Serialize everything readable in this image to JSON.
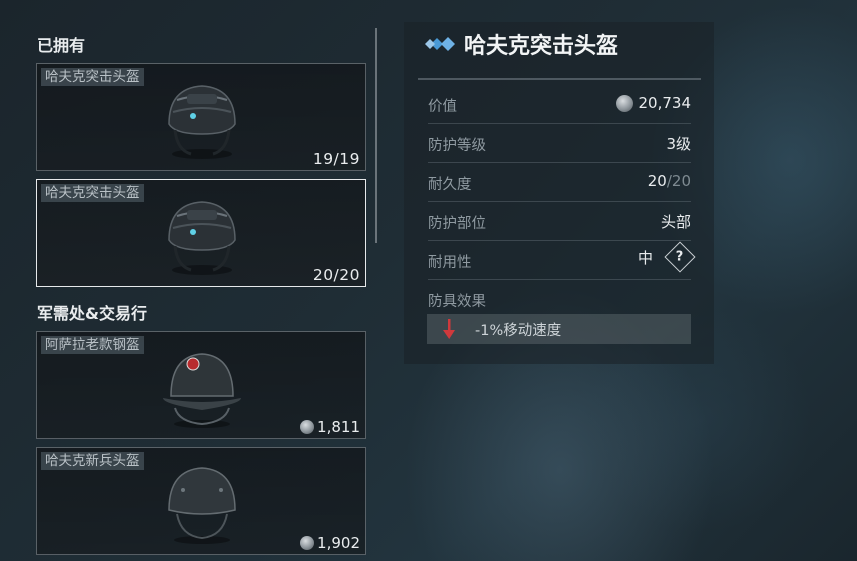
{
  "owned": {
    "title": "已拥有",
    "items": [
      {
        "name": "哈夫克突击头盔",
        "count": "19/19"
      },
      {
        "name": "哈夫克突击头盔",
        "count": "20/20"
      }
    ]
  },
  "market": {
    "title": "军需处&交易行",
    "items": [
      {
        "name": "阿萨拉老款钢盔",
        "price": "1,811"
      },
      {
        "name": "哈夫克新兵头盔",
        "price": "1,902"
      }
    ]
  },
  "detail": {
    "name": "哈夫克突击头盔",
    "value_label": "价值",
    "value": "20,734",
    "protection_label": "防护等级",
    "protection": "3级",
    "durability_label": "耐久度",
    "durability_current": "20",
    "durability_sep": "/",
    "durability_max": "20",
    "area_label": "防护部位",
    "area": "头部",
    "usability_label": "耐用性",
    "usability": "中",
    "help_glyph": "?",
    "effect_label": "防具效果",
    "effect": "-1%移动速度"
  },
  "colors": {
    "accent": "#5aa6e0",
    "debuff": "#d0393c",
    "selected_border": "#e6e9eb"
  },
  "icons": [
    "coin-icon",
    "diamond-rarity-icon",
    "help-icon",
    "down-arrow-icon",
    "helmet-icon"
  ]
}
